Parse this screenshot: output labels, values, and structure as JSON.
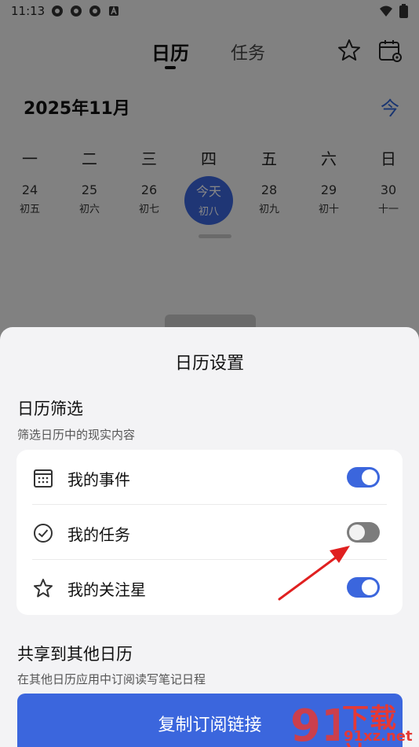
{
  "status_bar": {
    "time": "11:13",
    "icons": [
      "app-notification-icon",
      "app-notification-icon",
      "app-notification-icon",
      "text-a-icon"
    ],
    "right_icons": [
      "wifi-icon",
      "battery-icon"
    ]
  },
  "header": {
    "tabs": [
      {
        "label": "日历",
        "active": true
      },
      {
        "label": "任务",
        "active": false
      }
    ]
  },
  "calendar": {
    "month_label": "2025年11月",
    "today_button": "今",
    "weekdays": [
      "一",
      "二",
      "三",
      "四",
      "五",
      "六",
      "日"
    ],
    "days": [
      {
        "num": "24",
        "lunar": "初五"
      },
      {
        "num": "25",
        "lunar": "初六"
      },
      {
        "num": "26",
        "lunar": "初七"
      },
      {
        "num": "今天",
        "lunar": "初八",
        "today": true
      },
      {
        "num": "28",
        "lunar": "初九"
      },
      {
        "num": "29",
        "lunar": "初十"
      },
      {
        "num": "30",
        "lunar": "十一"
      }
    ]
  },
  "sheet": {
    "title": "日历设置",
    "filter": {
      "title": "日历筛选",
      "subtitle": "筛选日历中的现实内容",
      "items": [
        {
          "label": "我的事件",
          "icon": "calendar-icon",
          "enabled": true
        },
        {
          "label": "我的任务",
          "icon": "check-circle-icon",
          "enabled": false
        },
        {
          "label": "我的关注星",
          "icon": "star-icon",
          "enabled": true
        }
      ]
    },
    "share": {
      "title": "共享到其他日历",
      "subtitle": "在其他日历应用中订阅读写笔记日程",
      "button": "复制订阅链接"
    }
  },
  "watermark": {
    "name": "下载站",
    "site": "91xz.net"
  },
  "colors": {
    "accent": "#3b66dd",
    "toggle_off": "#7c7c7c",
    "sheet_bg": "#f3f3f5",
    "arrow": "#e02020"
  }
}
